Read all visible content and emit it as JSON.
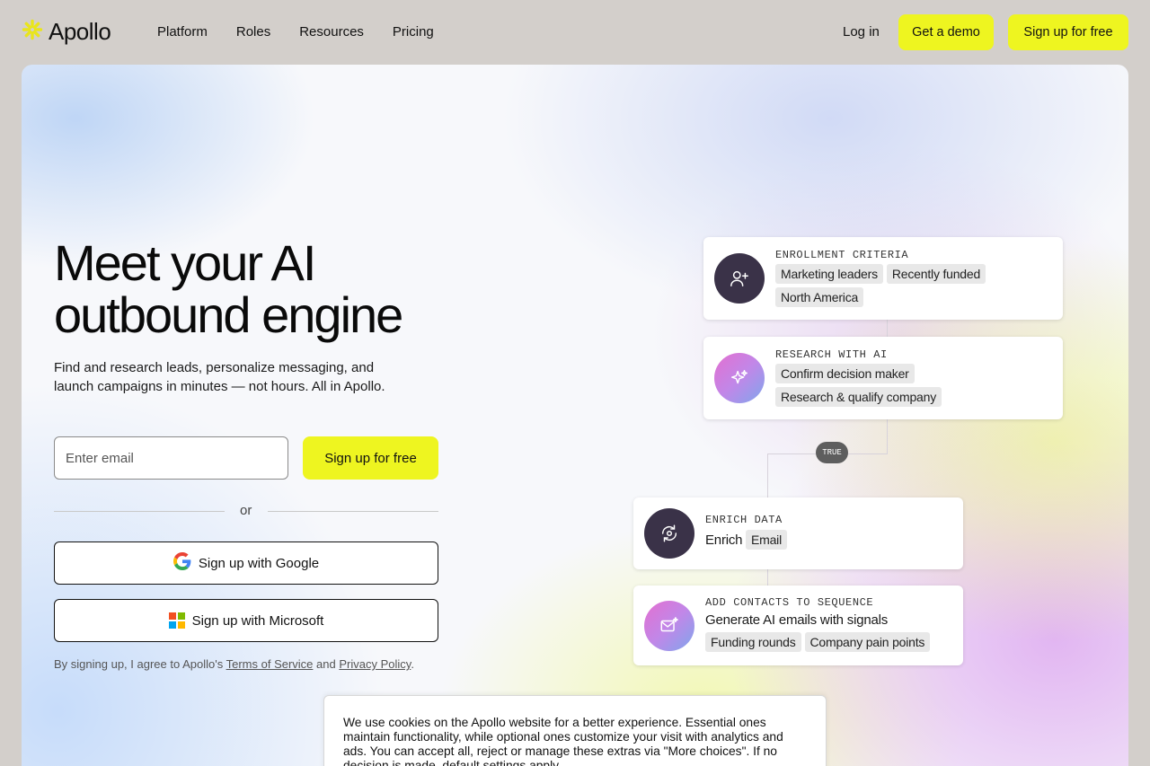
{
  "header": {
    "logo_text": "Apollo",
    "nav": [
      "Platform",
      "Roles",
      "Resources",
      "Pricing"
    ],
    "login_label": "Log in",
    "demo_label": "Get a demo",
    "signup_label": "Sign up for free",
    "accent_color": "#eef520"
  },
  "hero": {
    "headline_line1": "Meet your AI",
    "headline_line2": "outbound engine",
    "subtext": "Find and research leads, personalize messaging, and launch campaigns in minutes — not hours. All in Apollo.",
    "email_placeholder": "Enter email",
    "signup_label": "Sign up for free",
    "or_text": "or",
    "google_label": "Sign up with Google",
    "microsoft_label": "Sign up with Microsoft",
    "legal_prefix": "By signing up, I agree to Apollo's",
    "terms_label": "Terms of Service",
    "legal_and": "and",
    "privacy_label": "Privacy Policy",
    "legal_suffix": "."
  },
  "workflow": {
    "enrollment": {
      "title": "ENROLLMENT CRITERIA",
      "icon": "person-add-icon",
      "tags": [
        "Marketing leaders",
        "Recently funded",
        "North America"
      ]
    },
    "research": {
      "title": "RESEARCH WITH AI",
      "icon": "sparkle-icon",
      "tags": [
        "Confirm decision maker",
        "Research & qualify company"
      ]
    },
    "true_label": "TRUE",
    "enrich": {
      "title": "ENRICH DATA",
      "icon": "refresh-search-icon",
      "text": "Enrich",
      "tags": [
        "Email"
      ]
    },
    "sequence": {
      "title": "ADD CONTACTS TO SEQUENCE",
      "icon": "mail-sparkle-icon",
      "text": "Generate AI emails with signals",
      "tags": [
        "Funding rounds",
        "Company pain points"
      ]
    }
  },
  "cookie": {
    "text": "We use cookies on the Apollo website for a better experience. Essential ones maintain functionality, while optional ones customize your visit with analytics and ads. You can accept all, reject or manage these extras via \"More choices\". If no decision is made, default settings apply."
  }
}
